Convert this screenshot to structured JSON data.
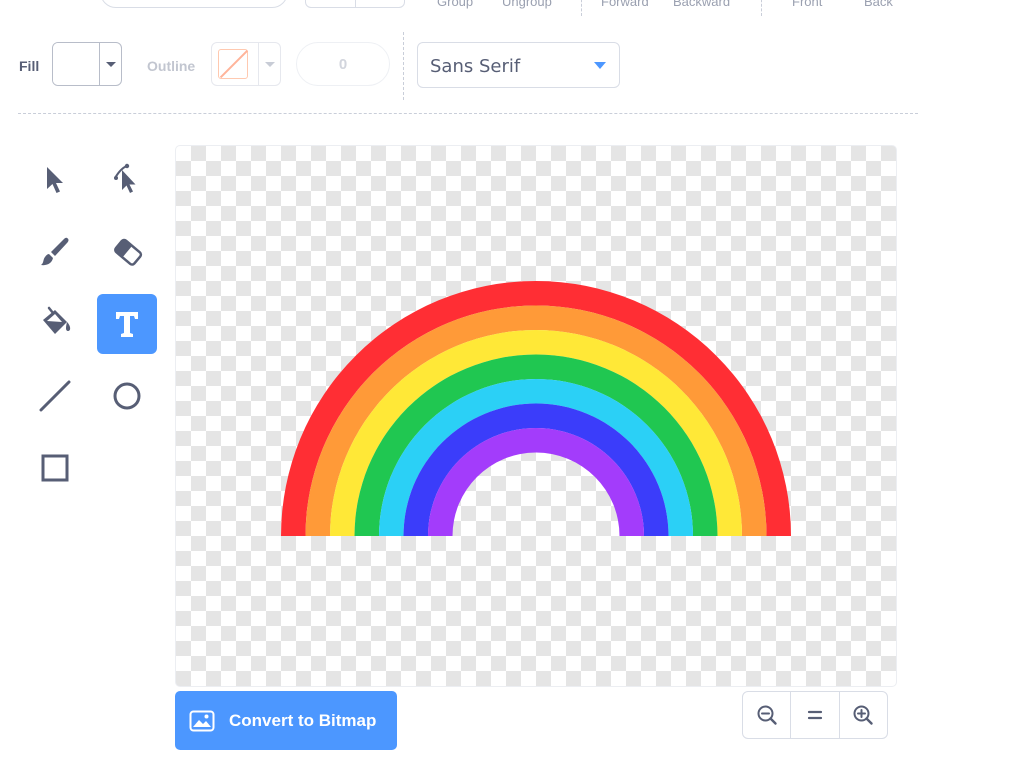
{
  "toolbar_top": {
    "group_label": "Group",
    "ungroup_label": "Ungroup",
    "forward_label": "Forward",
    "backward_label": "Backward",
    "front_label": "Front",
    "back_label": "Back"
  },
  "fill": {
    "label": "Fill",
    "color": "#ffffff"
  },
  "outline": {
    "label": "Outline",
    "color": "none",
    "width_value": "0"
  },
  "font": {
    "selected": "Sans Serif"
  },
  "tools": {
    "items": [
      {
        "name": "select",
        "icon": "select-arrow-icon",
        "selected": false
      },
      {
        "name": "reshape",
        "icon": "reshape-icon",
        "selected": false
      },
      {
        "name": "brush",
        "icon": "brush-icon",
        "selected": false
      },
      {
        "name": "eraser",
        "icon": "eraser-icon",
        "selected": false
      },
      {
        "name": "fill",
        "icon": "paint-bucket-icon",
        "selected": false
      },
      {
        "name": "text",
        "icon": "text-icon",
        "selected": true
      },
      {
        "name": "line",
        "icon": "line-icon",
        "selected": false
      },
      {
        "name": "circle",
        "icon": "circle-icon",
        "selected": false
      },
      {
        "name": "rectangle",
        "icon": "rectangle-icon",
        "selected": false
      }
    ]
  },
  "canvas": {
    "costume": "rainbow",
    "rainbow_colors": [
      "#ff2e34",
      "#ff9a38",
      "#ffe837",
      "#20c751",
      "#2bd0f6",
      "#3b3dfa",
      "#a33cfb"
    ]
  },
  "bottom": {
    "convert_label": "Convert to Bitmap",
    "convert_icon": "image-icon",
    "zoom_out_icon": "zoom-out-icon",
    "zoom_reset_icon": "zoom-reset-icon",
    "zoom_in_icon": "zoom-in-icon"
  },
  "colors": {
    "accent": "#4c97ff",
    "text": "#575e75"
  }
}
